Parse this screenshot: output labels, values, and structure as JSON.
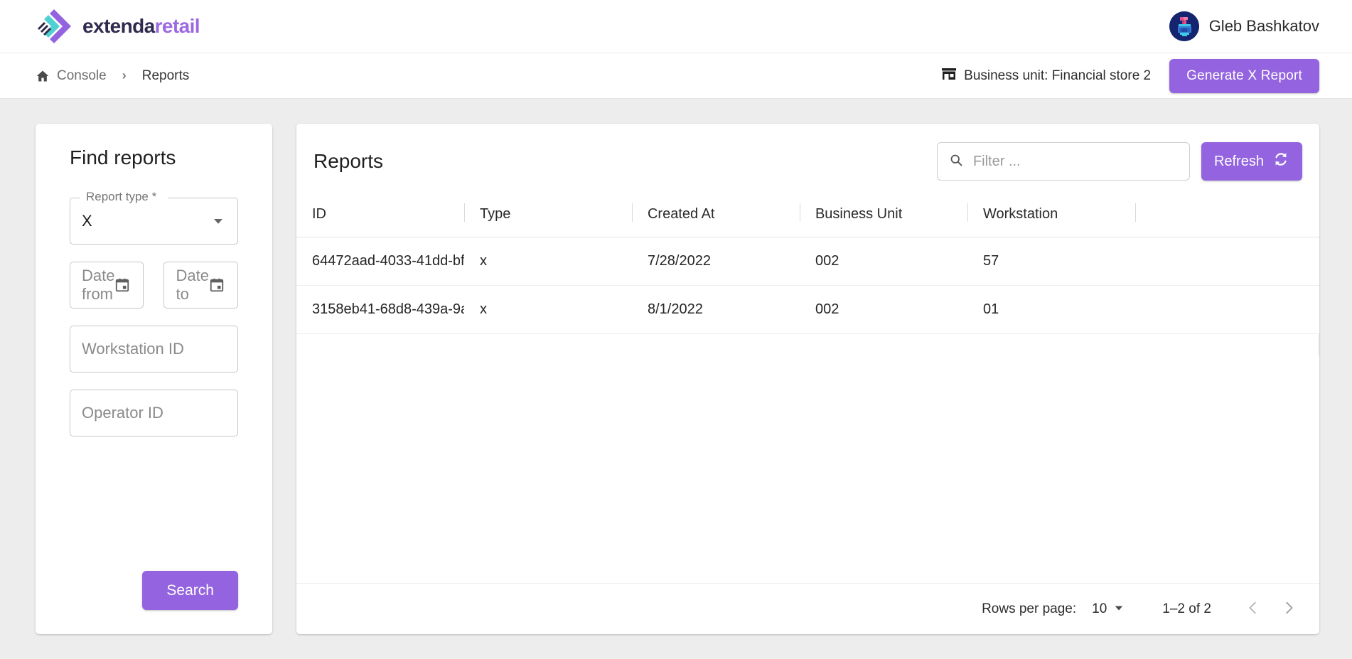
{
  "brand": {
    "word1": "extenda",
    "word2": "retail"
  },
  "user": {
    "name": "Gleb Bashkatov",
    "avatar_icon": "user-avatar-pixel"
  },
  "breadcrumb": {
    "home_icon": "home-icon",
    "console_label": "Console",
    "separator": "›",
    "current_label": "Reports"
  },
  "header_actions": {
    "business_unit_icon": "store-icon",
    "business_unit_label": "Business unit: Financial store 2",
    "generate_button_label": "Generate X Report"
  },
  "find_reports": {
    "title": "Find reports",
    "report_type": {
      "label": "Report type",
      "required_marker": "*",
      "value": "X",
      "dropdown_icon": "chevron-down-icon"
    },
    "date_from": {
      "placeholder": "Date from",
      "value": "",
      "icon": "calendar-icon"
    },
    "date_to": {
      "placeholder": "Date to",
      "value": "",
      "icon": "calendar-icon"
    },
    "workstation_id": {
      "placeholder": "Workstation ID",
      "value": ""
    },
    "operator_id": {
      "placeholder": "Operator ID",
      "value": ""
    },
    "search_button_label": "Search"
  },
  "reports_panel": {
    "title": "Reports",
    "filter": {
      "placeholder": "Filter ...",
      "value": "",
      "icon": "search-icon"
    },
    "refresh_button_label": "Refresh",
    "refresh_icon": "refresh-icon",
    "columns": [
      "ID",
      "Type",
      "Created At",
      "Business Unit",
      "Workstation"
    ],
    "rows": [
      {
        "id": "64472aad-4033-41dd-bf…",
        "type": "x",
        "created_at": "7/28/2022",
        "business_unit": "002",
        "workstation": "57"
      },
      {
        "id": "3158eb41-68d8-439a-9a…",
        "type": "x",
        "created_at": "8/1/2022",
        "business_unit": "002",
        "workstation": "01"
      }
    ],
    "pagination": {
      "rows_per_page_label": "Rows per page:",
      "rows_per_page_value": "10",
      "rows_per_page_icon": "chevron-down-icon",
      "range_label": "1–2 of 2",
      "prev_icon": "chevron-left-icon",
      "next_icon": "chevron-right-icon"
    }
  },
  "colors": {
    "accent_purple": "#9464e0",
    "brand_dark": "#302b4e",
    "brand_teal": "#4fd0d2",
    "page_background": "#ededed",
    "avatar_background": "#15246e"
  }
}
